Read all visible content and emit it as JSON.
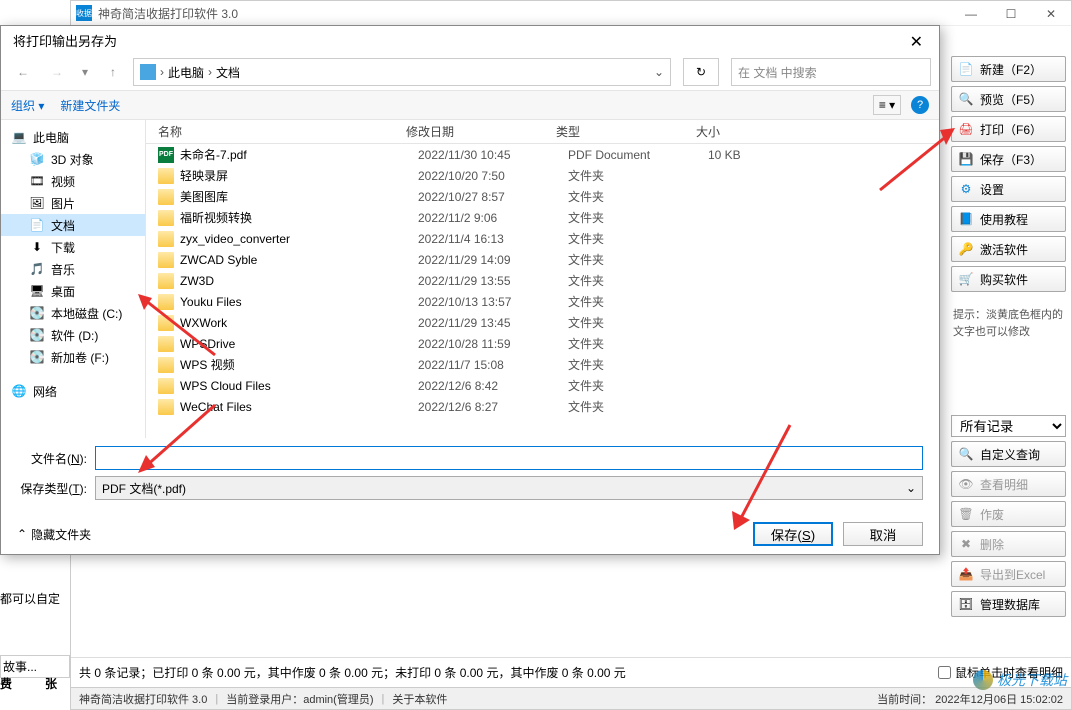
{
  "app": {
    "title": "神奇简洁收据打印软件 3.0",
    "win_min": "—",
    "win_max": "☐",
    "win_close": "✕"
  },
  "sidebar_buttons": [
    {
      "icon": "📄",
      "color": "#0a84d6",
      "label": "新建（F2）"
    },
    {
      "icon": "🔍",
      "color": "#888",
      "label": "预览（F5）"
    },
    {
      "icon": "🖨",
      "color": "#e8312f",
      "label": "打印（F6）"
    },
    {
      "icon": "💾",
      "color": "#0a84d6",
      "label": "保存（F3）"
    },
    {
      "icon": "⚙",
      "color": "#0a84d6",
      "label": "设置"
    },
    {
      "icon": "📘",
      "color": "#0a84d6",
      "label": "使用教程"
    },
    {
      "icon": "🔑",
      "color": "#e8312f",
      "label": "激活软件"
    },
    {
      "icon": "🛒",
      "color": "#e8312f",
      "label": "购买软件"
    }
  ],
  "hint": "提示：淡黄底色框内的文字也可以修改",
  "records_select": "所有记录",
  "record_buttons": [
    {
      "icon": "🔍",
      "label": "自定义查询",
      "disabled": false
    },
    {
      "icon": "👁",
      "label": "查看明细",
      "disabled": true
    },
    {
      "icon": "🗑",
      "label": "作废",
      "disabled": true
    },
    {
      "icon": "✖",
      "label": "删除",
      "disabled": true
    },
    {
      "icon": "📤",
      "label": "导出到Excel",
      "disabled": true
    },
    {
      "icon": "🗄",
      "label": "管理数据库",
      "disabled": false
    }
  ],
  "bottom": {
    "summary": "共 0 条记录；已打印 0 条 0.00 元，其中作废 0 条 0.00 元；未打印 0 条 0.00 元，其中作废 0 条 0.00 元",
    "checkbox": "鼠标单击时查看明细"
  },
  "status": {
    "app": "神奇简洁收据打印软件 3.0",
    "user_label": "当前登录用户：",
    "user": "admin(管理员)",
    "about": "关于本软件",
    "time_label": "当前时间：",
    "time": "2022年12月06日 15:02:02"
  },
  "left_frag": {
    "a": "都可以自定",
    "b": "故事...",
    "c": "费",
    "d": "张"
  },
  "dialog": {
    "title": "将打印输出另存为",
    "breadcrumb": [
      "此电脑",
      "文档"
    ],
    "search_placeholder": "在 文档 中搜索",
    "organize": "组织",
    "new_folder": "新建文件夹",
    "tree": [
      {
        "icon": "💻",
        "label": "此电脑",
        "indent": false
      },
      {
        "icon": "🧊",
        "label": "3D 对象",
        "indent": true
      },
      {
        "icon": "🎞",
        "label": "视频",
        "indent": true
      },
      {
        "icon": "🖼",
        "label": "图片",
        "indent": true
      },
      {
        "icon": "📄",
        "label": "文档",
        "indent": true,
        "selected": true
      },
      {
        "icon": "⬇",
        "label": "下载",
        "indent": true
      },
      {
        "icon": "🎵",
        "label": "音乐",
        "indent": true
      },
      {
        "icon": "🖥",
        "label": "桌面",
        "indent": true
      },
      {
        "icon": "💽",
        "label": "本地磁盘 (C:)",
        "indent": true
      },
      {
        "icon": "💽",
        "label": "软件 (D:)",
        "indent": true
      },
      {
        "icon": "💽",
        "label": "新加卷 (F:)",
        "indent": true
      }
    ],
    "tree_network": {
      "icon": "🌐",
      "label": "网络"
    },
    "columns": {
      "name": "名称",
      "date": "修改日期",
      "type": "类型",
      "size": "大小"
    },
    "files": [
      {
        "icon": "pdf",
        "name": "未命名-7.pdf",
        "date": "2022/11/30 10:45",
        "type": "PDF Document",
        "size": "10 KB"
      },
      {
        "icon": "folder",
        "name": "轻映录屏",
        "date": "2022/10/20 7:50",
        "type": "文件夹",
        "size": ""
      },
      {
        "icon": "folder",
        "name": "美图图库",
        "date": "2022/10/27 8:57",
        "type": "文件夹",
        "size": ""
      },
      {
        "icon": "folder",
        "name": "福昕视频转换",
        "date": "2022/11/2 9:06",
        "type": "文件夹",
        "size": ""
      },
      {
        "icon": "folder",
        "name": "zyx_video_converter",
        "date": "2022/11/4 16:13",
        "type": "文件夹",
        "size": ""
      },
      {
        "icon": "folder",
        "name": "ZWCAD Syble",
        "date": "2022/11/29 14:09",
        "type": "文件夹",
        "size": ""
      },
      {
        "icon": "folder",
        "name": "ZW3D",
        "date": "2022/11/29 13:55",
        "type": "文件夹",
        "size": ""
      },
      {
        "icon": "folder",
        "name": "Youku Files",
        "date": "2022/10/13 13:57",
        "type": "文件夹",
        "size": ""
      },
      {
        "icon": "folder",
        "name": "WXWork",
        "date": "2022/11/29 13:45",
        "type": "文件夹",
        "size": ""
      },
      {
        "icon": "folder",
        "name": "WPSDrive",
        "date": "2022/10/28 11:59",
        "type": "文件夹",
        "size": ""
      },
      {
        "icon": "folder",
        "name": "WPS 视频",
        "date": "2022/11/7 15:08",
        "type": "文件夹",
        "size": ""
      },
      {
        "icon": "folder",
        "name": "WPS Cloud Files",
        "date": "2022/12/6 8:42",
        "type": "文件夹",
        "size": ""
      },
      {
        "icon": "folder",
        "name": "WeChat Files",
        "date": "2022/12/6 8:27",
        "type": "文件夹",
        "size": ""
      }
    ],
    "filename_label": "文件名(N):",
    "filename_value": "",
    "filetype_label": "保存类型(T):",
    "filetype_value": "PDF 文档(*.pdf)",
    "hide_folders": "隐藏文件夹",
    "save_btn": "保存(S)",
    "cancel_btn": "取消"
  },
  "watermark": "极光下载站"
}
